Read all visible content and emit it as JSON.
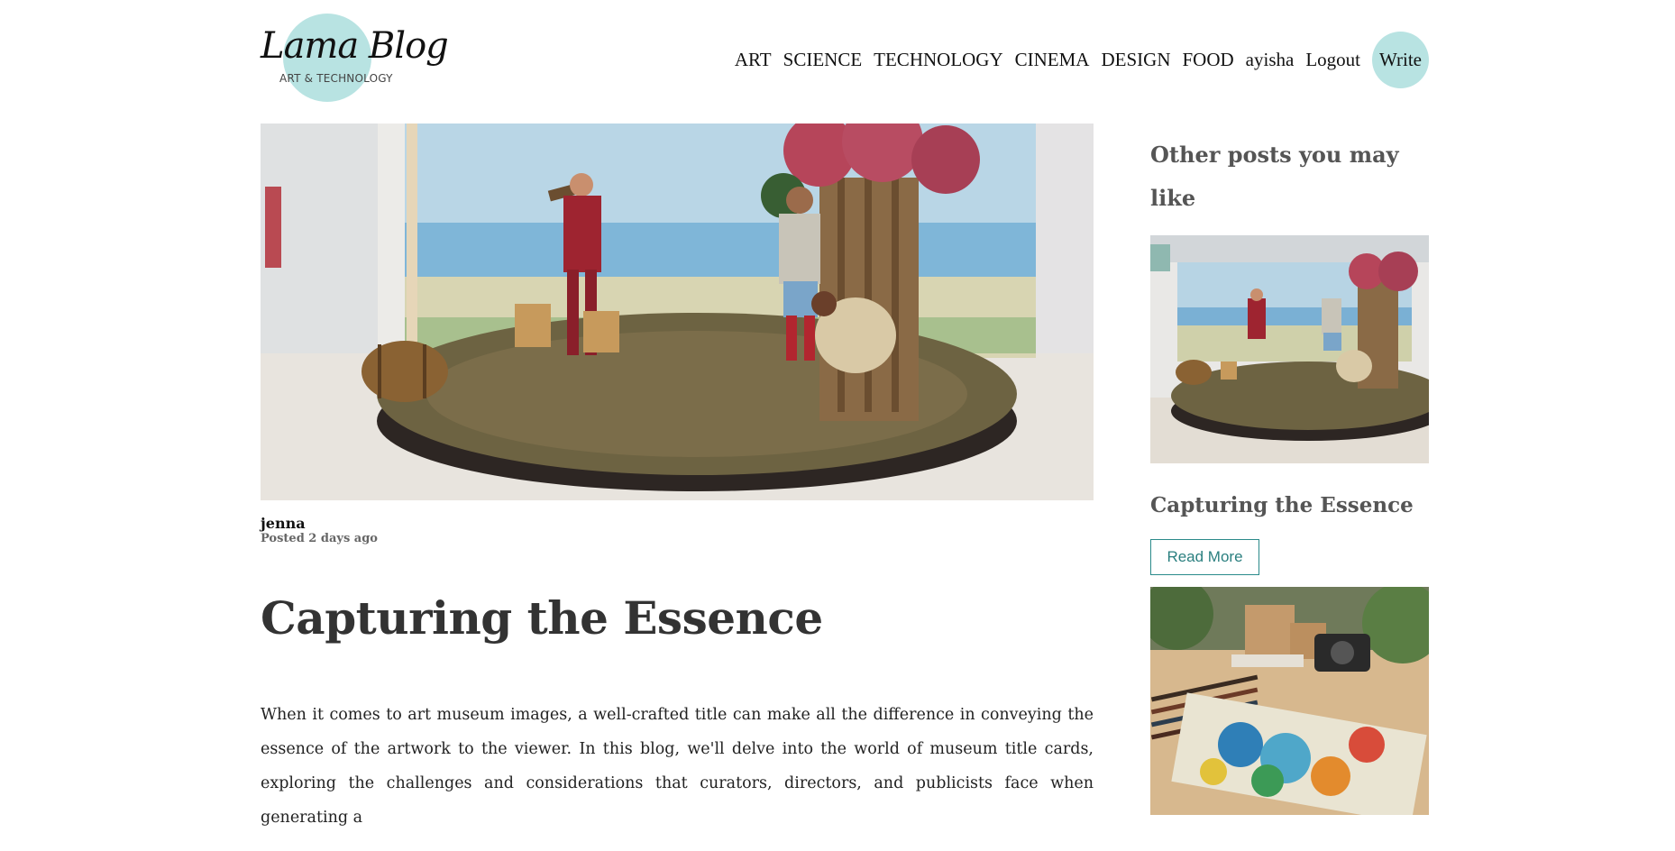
{
  "logo": {
    "title": "Lama Blog",
    "subtitle": "ART & TECHNOLOGY"
  },
  "nav": {
    "links": [
      "ART",
      "SCIENCE",
      "TECHNOLOGY",
      "CINEMA",
      "DESIGN",
      "FOOD",
      "ayisha",
      "Logout"
    ],
    "write_label": "Write"
  },
  "post": {
    "author": "jenna",
    "posted": "Posted 2 days ago",
    "title": "Capturing the Essence",
    "body": "When it comes to art museum images, a well-crafted title can make all the difference in conveying the essence of the artwork to the viewer. In this blog, we'll delve into the world of museum title cards, exploring the challenges and considerations that curators, directors, and publicists face when generating a"
  },
  "sidebar": {
    "heading": "Other posts you may like",
    "cards": [
      {
        "title": "Capturing the Essence",
        "read_more": "Read More"
      }
    ]
  },
  "colors": {
    "accent": "#b8e3e2",
    "read_more_border": "#2a8a8a",
    "heading_gray": "#555555"
  }
}
